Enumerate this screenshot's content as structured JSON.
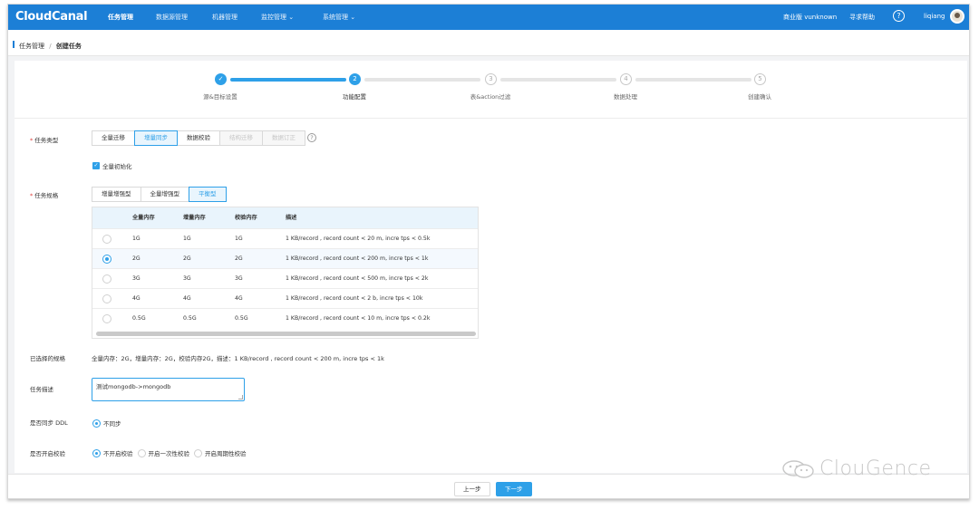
{
  "app": {
    "logo": "CloudCanal",
    "nav": [
      "任务管理",
      "数据源管理",
      "机器管理",
      "监控管理 ⌄",
      "系统管理 ⌄"
    ],
    "edition": "商业版 vunknown",
    "help": "寻求帮助",
    "help_icon": "?",
    "user": "liqiang"
  },
  "breadcrumb": {
    "parent": "任务管理",
    "separator": "/",
    "current": "创建任务"
  },
  "steps": {
    "items": [
      {
        "label": "源&目标设置",
        "mark": "✓",
        "state": "done"
      },
      {
        "label": "功能配置",
        "mark": "2",
        "state": "current"
      },
      {
        "label": "表&action过滤",
        "mark": "3",
        "state": "todo"
      },
      {
        "label": "数据处理",
        "mark": "4",
        "state": "todo"
      },
      {
        "label": "创建确认",
        "mark": "5",
        "state": "todo"
      }
    ]
  },
  "form": {
    "task_type": {
      "label": "任务类型",
      "required_mark": "*",
      "options": [
        "全量迁移",
        "增量同步",
        "数据校验",
        "结构迁移",
        "数据订正"
      ],
      "selected": "增量同步",
      "help_icon": "?"
    },
    "full_init": {
      "label": "全量初始化",
      "checked": true,
      "check_mark": "✓"
    },
    "task_spec": {
      "label": "任务规格",
      "required_mark": "*",
      "options": [
        "增量增强型",
        "全量增强型",
        "平衡型"
      ],
      "selected": "平衡型"
    },
    "spec_table": {
      "columns": [
        "",
        "全量内存",
        "增量内存",
        "校验内存",
        "描述"
      ],
      "rows": [
        {
          "full": "1G",
          "incr": "1G",
          "check": "1G",
          "desc": "1 KB/record , record count < 20 m, incre tps < 0.5k",
          "selected": false
        },
        {
          "full": "2G",
          "incr": "2G",
          "check": "2G",
          "desc": "1 KB/record , record count < 200 m, incre tps < 1k",
          "selected": true
        },
        {
          "full": "3G",
          "incr": "3G",
          "check": "3G",
          "desc": "1 KB/record , record count < 500 m, incre tps < 2k",
          "selected": false
        },
        {
          "full": "4G",
          "incr": "4G",
          "check": "4G",
          "desc": "1 KB/record , record count < 2 b, incre tps < 10k",
          "selected": false
        },
        {
          "full": "0.5G",
          "incr": "0.5G",
          "check": "0.5G",
          "desc": "1 KB/record , record count < 10 m, incre tps < 0.2k",
          "selected": false
        }
      ]
    },
    "selected_spec": {
      "label": "已选择的规格",
      "value": "全量内存：2G，增量内存：2G，校验内存2G，描述：1 KB/record , record count < 200 m, incre tps < 1k"
    },
    "description": {
      "label": "任务描述",
      "value": "测试mongodb->mongodb"
    },
    "sync_ddl": {
      "label": "是否同步 DDL",
      "options": [
        "不同步"
      ],
      "selected": "不同步"
    },
    "verify": {
      "label": "是否开启校验",
      "options": [
        "不开启校验",
        "开启一次性校验",
        "开启周期性校验"
      ],
      "selected": "不开启校验"
    }
  },
  "footer": {
    "prev": "上一步",
    "next": "下一步"
  },
  "watermark": "ClouGence",
  "colors": {
    "brand": "#1c7fd6",
    "accent": "#2ea0e8",
    "required": "#e0403d"
  }
}
